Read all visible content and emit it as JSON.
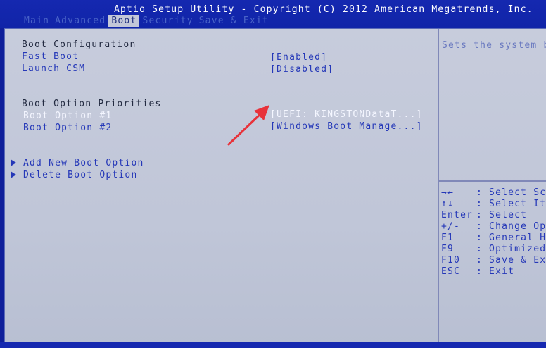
{
  "header": {
    "title": "Aptio Setup Utility - Copyright (C) 2012 American Megatrends, Inc.",
    "tabs": [
      {
        "label": "Main",
        "active": false
      },
      {
        "label": "Advanced",
        "active": false
      },
      {
        "label": "Boot",
        "active": true
      },
      {
        "label": "Security",
        "active": false
      },
      {
        "label": "Save & Exit",
        "active": false
      }
    ]
  },
  "boot": {
    "config_heading": "Boot Configuration",
    "fast_boot": {
      "label": "Fast Boot",
      "value": "[Enabled]"
    },
    "launch_csm": {
      "label": "Launch CSM",
      "value": "[Disabled]"
    },
    "priorities_heading": "Boot Option Priorities",
    "option1": {
      "label": "Boot Option #1",
      "value": "[UEFI: KINGSTONDataT...]"
    },
    "option2": {
      "label": "Boot Option #2",
      "value": "[Windows Boot Manage...]"
    },
    "add_option": "Add New Boot Option",
    "delete_option": "Delete Boot Option"
  },
  "help": {
    "description": "Sets the system b",
    "keys": [
      {
        "key": "→←",
        "action": ": Select Scr"
      },
      {
        "key": "↑↓",
        "action": ": Select Ite"
      },
      {
        "key": "Enter",
        "action": ": Select"
      },
      {
        "key": "+/-",
        "action": ": Change Opt"
      },
      {
        "key": "F1",
        "action": ": General He"
      },
      {
        "key": "F9",
        "action": ": Optimized D"
      },
      {
        "key": "F10",
        "action": ": Save & Exi"
      },
      {
        "key": "ESC",
        "action": ": Exit"
      }
    ]
  },
  "colors": {
    "background": "#0f1f9a",
    "panel": "#c3c7d8",
    "highlight": "#2538b8",
    "annotation_arrow": "#e8323a"
  }
}
